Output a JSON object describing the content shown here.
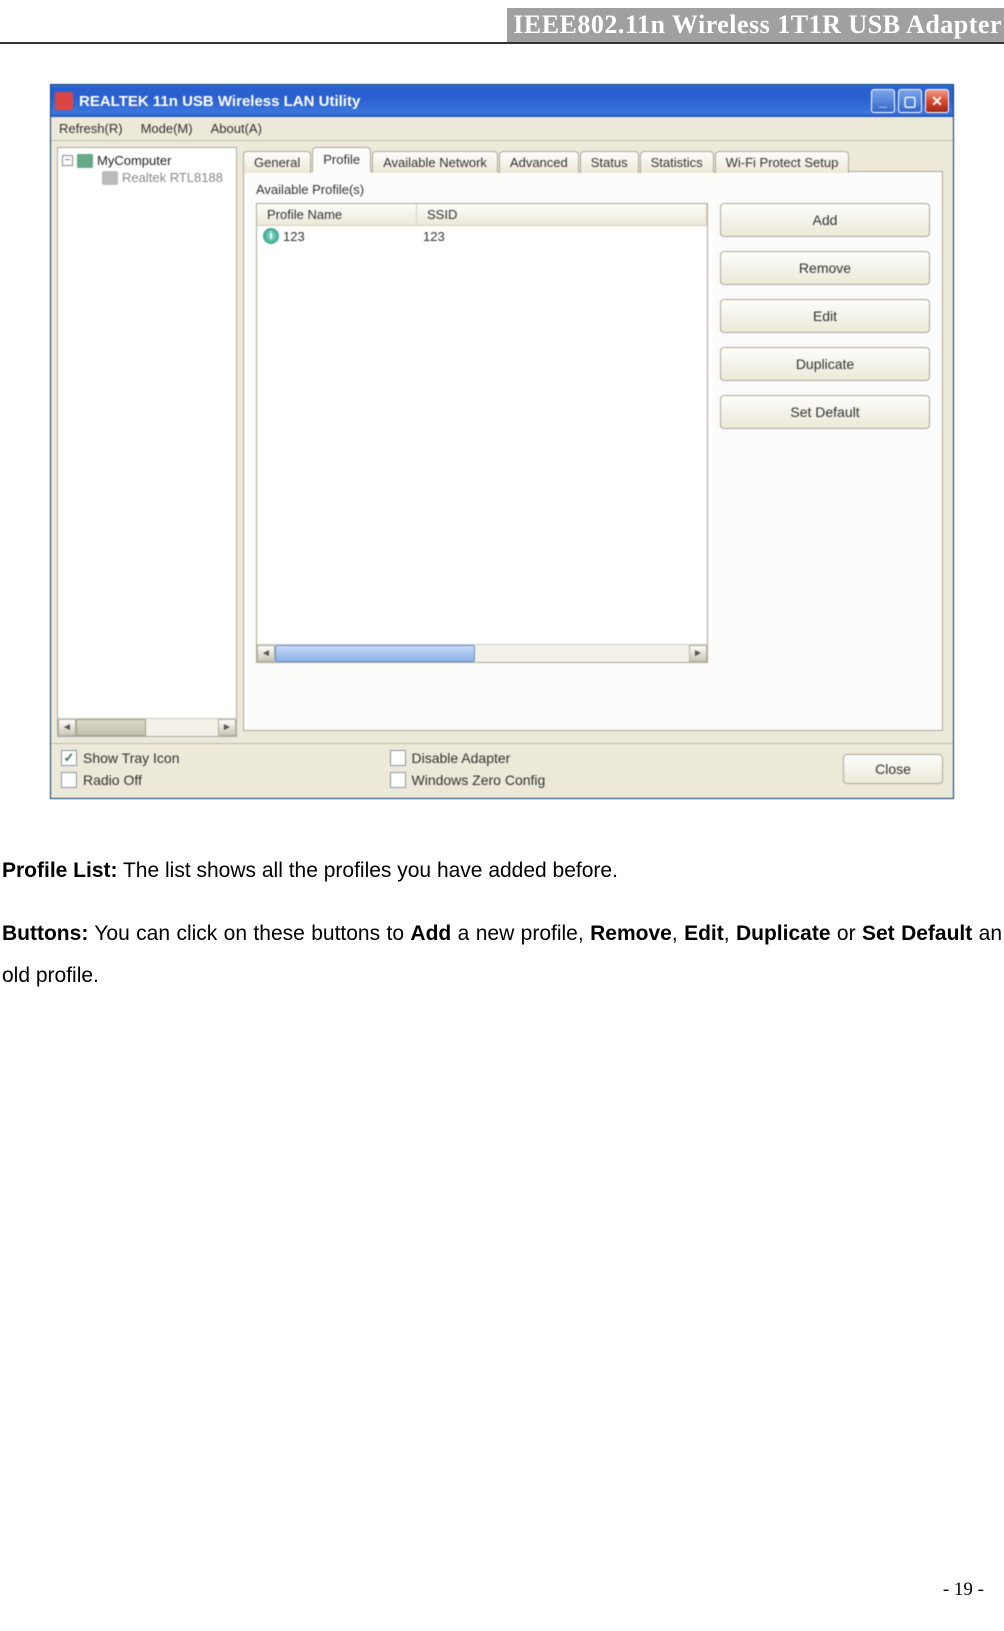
{
  "doc": {
    "header_title": "IEEE802.11n Wireless 1T1R USB Adapter",
    "page_number": "- 19 -"
  },
  "window": {
    "title": "REALTEK 11n USB Wireless LAN Utility",
    "menu": {
      "refresh": "Refresh(R)",
      "mode": "Mode(M)",
      "about": "About(A)"
    },
    "tree": {
      "root": "MyComputer",
      "child": "Realtek RTL8188",
      "box_glyph": "−"
    },
    "tabs": {
      "general": "General",
      "profile": "Profile",
      "available": "Available Network",
      "advanced": "Advanced",
      "status": "Status",
      "statistics": "Statistics",
      "wifiprotect": "Wi-Fi Protect Setup"
    },
    "panel": {
      "label": "Available Profile(s)",
      "col_name": "Profile Name",
      "col_ssid": "SSID",
      "row_name": "123",
      "row_ssid": "123"
    },
    "buttons": {
      "add": "Add",
      "remove": "Remove",
      "edit": "Edit",
      "duplicate": "Duplicate",
      "setdefault": "Set Default",
      "close": "Close"
    },
    "footer": {
      "show_tray": "Show Tray Icon",
      "radio_off": "Radio Off",
      "disable_adapter": "Disable Adapter",
      "zero_config": "Windows Zero Config",
      "check_glyph": "✓"
    }
  },
  "text": {
    "p1_b": "Profile List:",
    "p1_rest": " The list shows all the profiles you have added before.",
    "p2_b1": "Buttons:",
    "p2_a": " You can click on these buttons to ",
    "p2_b2": "Add",
    "p2_b": " a new profile, ",
    "p2_b3": "Remove",
    "p2_c": ", ",
    "p2_b4": "Edit",
    "p2_d": ", ",
    "p2_b5": "Duplicate",
    "p2_e": " or ",
    "p2_b6": "Set Default",
    "p2_f": " an old profile."
  }
}
